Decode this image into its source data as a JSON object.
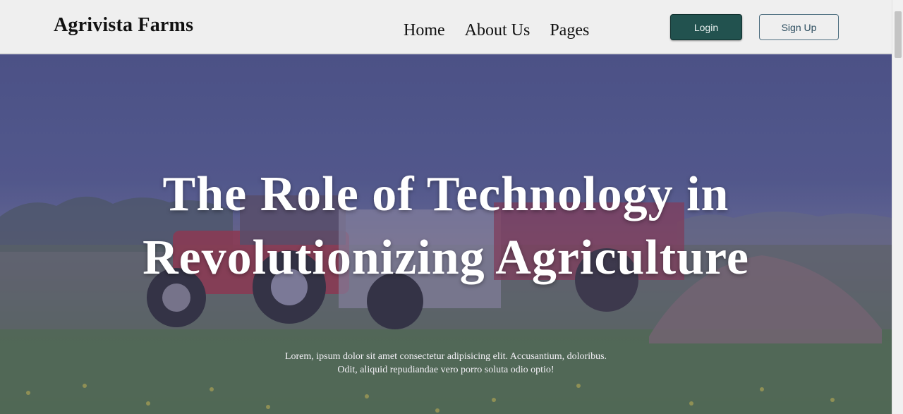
{
  "brand": {
    "name": "Agrivista Farms"
  },
  "nav": {
    "links": [
      {
        "label": "Home"
      },
      {
        "label": "About Us"
      },
      {
        "label": "Pages"
      }
    ],
    "login_label": "Login",
    "signup_label": "Sign Up"
  },
  "hero": {
    "title": "The Role of Technology in Revolutionizing Agriculture",
    "text": "Lorem, ipsum dolor sit amet consectetur adipisicing elit. Accusantium, doloribus. Odit, aliquid repudiandae vero porro soluta odio optio!",
    "image_subject": "red tractors working in a farm field"
  },
  "colors": {
    "login_button": "#22524f",
    "signup_border": "#4f6f80",
    "hero_overlay": "#4b468c"
  }
}
